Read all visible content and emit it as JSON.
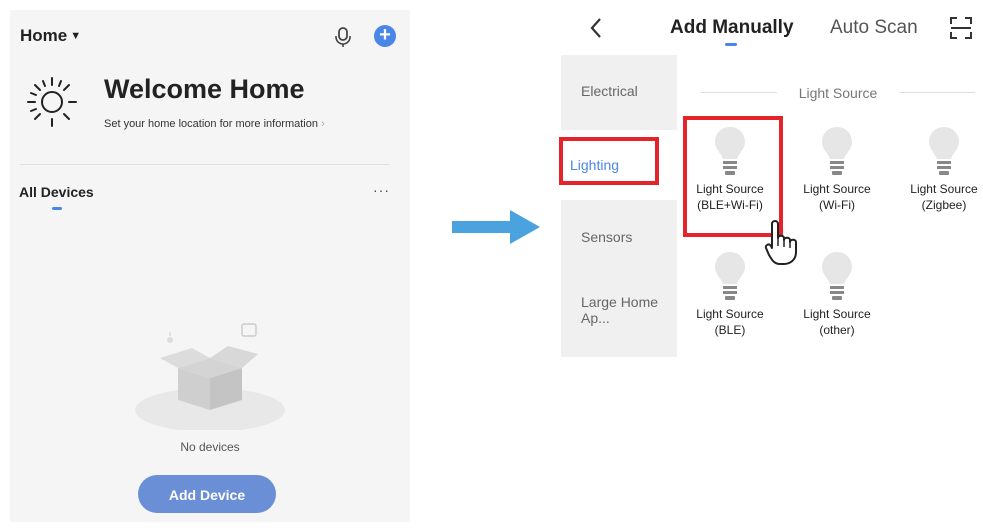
{
  "left": {
    "home_label": "Home",
    "welcome_title": "Welcome Home",
    "set_location": "Set your home location for more information",
    "all_devices": "All Devices",
    "more": "···",
    "no_devices": "No devices",
    "add_device": "Add Device",
    "plus": "+"
  },
  "right": {
    "tabs": [
      "Add Manually",
      "Auto Scan"
    ],
    "categories": [
      "Electrical",
      "Lighting",
      "Sensors",
      "Large Home Ap..."
    ],
    "section_header": "Light Source",
    "devices": [
      {
        "line1": "Light Source",
        "line2": "(BLE+Wi-Fi)"
      },
      {
        "line1": "Light Source",
        "line2": "(Wi-Fi)"
      },
      {
        "line1": "Light Source",
        "line2": "(Zigbee)"
      },
      {
        "line1": "Light Source",
        "line2": "(BLE)"
      },
      {
        "line1": "Light Source",
        "line2": "(other)"
      }
    ]
  },
  "colors": {
    "accent": "#4a86e8",
    "highlight": "#e3242b",
    "arrow": "#4aa3df"
  }
}
